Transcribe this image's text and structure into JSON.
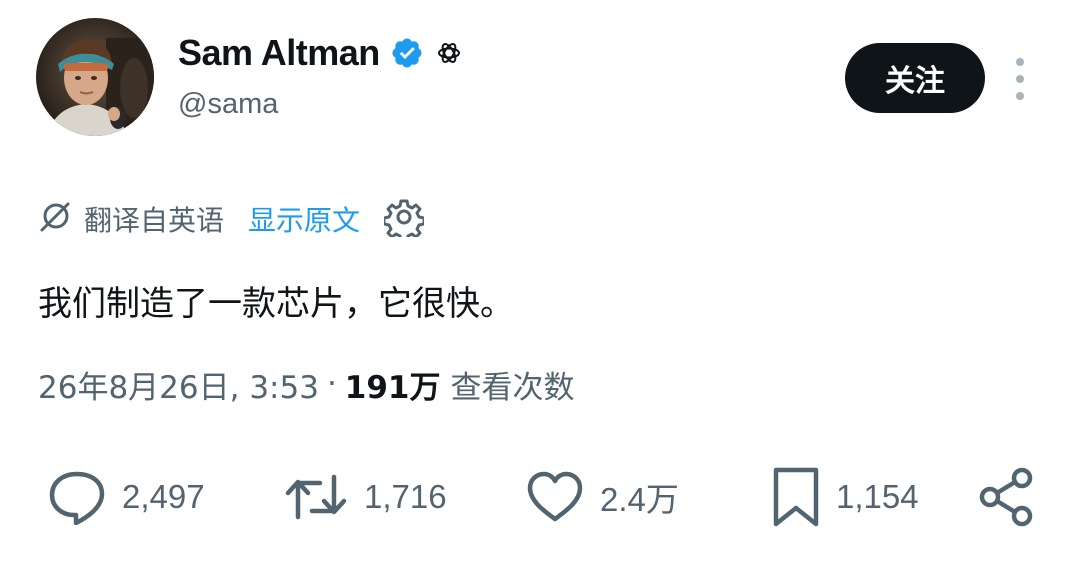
{
  "author": {
    "display_name": "Sam Altman",
    "handle": "@sama",
    "verified_badge": "verified-badge-icon",
    "affiliation_badge": "openai-logo-icon",
    "avatar": "avatar-photo"
  },
  "header": {
    "follow_label": "关注",
    "more_icon": "more-vertical-icon"
  },
  "translation": {
    "icon": "translate-icon",
    "label": "翻译自英语",
    "show_original_label": "显示原文",
    "settings_icon": "gear-icon"
  },
  "tweet": {
    "text": "我们制造了一款芯片，它很快。"
  },
  "meta": {
    "timestamp": "26年8月26日, 3:53",
    "separator": "·",
    "views_count": "191万",
    "views_label": "查看次数"
  },
  "actions": {
    "reply_count": "2,497",
    "retweet_count": "1,716",
    "like_count": "2.4万",
    "bookmark_count": "1,154"
  },
  "colors": {
    "text_primary": "#0f1419",
    "text_secondary": "#536471",
    "link": "#1d9bf0",
    "verified": "#1d9bf0",
    "follow_bg": "#0f1419"
  }
}
